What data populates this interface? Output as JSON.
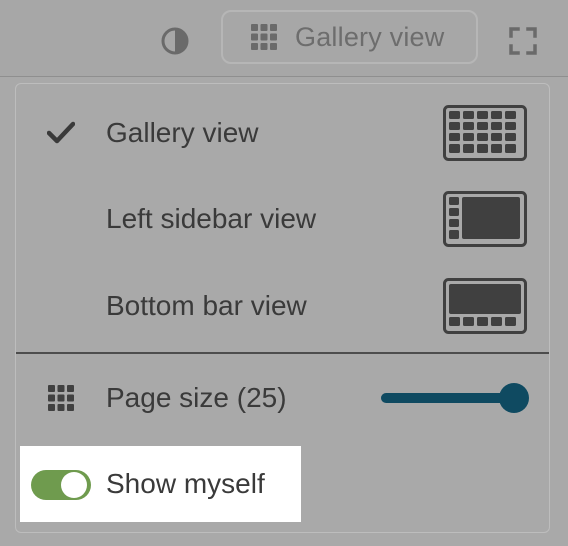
{
  "toolbar": {
    "view_button_label": "Gallery view",
    "icons": {
      "contrast": "contrast-icon",
      "grid": "grid-icon",
      "fullscreen": "fullscreen-icon"
    }
  },
  "menu": {
    "items": [
      {
        "label": "Gallery view",
        "selected": true,
        "icon": "gallery-layout-icon"
      },
      {
        "label": "Left sidebar view",
        "selected": false,
        "icon": "left-sidebar-layout-icon"
      },
      {
        "label": "Bottom bar view",
        "selected": false,
        "icon": "bottom-bar-layout-icon"
      }
    ],
    "page_size": {
      "label": "Page size (25)",
      "slider_value_fraction": 1.0
    },
    "show_myself": {
      "label": "Show myself",
      "enabled": true
    }
  },
  "colors": {
    "background": "#a9a9a9",
    "slider": "#0f4a61",
    "toggle_on": "#6f9b4e",
    "text": "#3a3a3a",
    "icon_dark": "#404040"
  }
}
